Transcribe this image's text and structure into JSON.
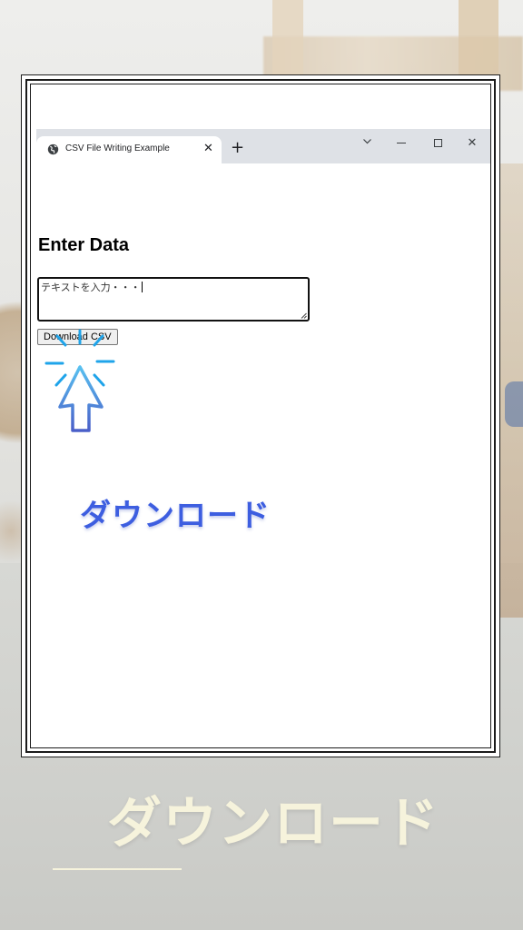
{
  "browser": {
    "tab_title": "CSV File Writing Example",
    "tab_close": "✕",
    "new_tab": "+",
    "window_controls": {
      "dropdown": "⌵",
      "close": "✕"
    }
  },
  "page": {
    "heading": "Enter Data",
    "textarea_value": "テキストを入力・・・",
    "download_button": "Download CSV"
  },
  "overlay": {
    "caption_blue": "ダウンロード",
    "caption_big": "ダウンロード",
    "accent_blue": "#3d5ee0",
    "caption_cream": "#f6f3dc"
  },
  "icons": [
    "globe-icon",
    "close-icon",
    "plus-icon",
    "chevron-down-icon",
    "minimize-icon",
    "maximize-icon",
    "window-close-icon",
    "click-cursor-icon"
  ]
}
